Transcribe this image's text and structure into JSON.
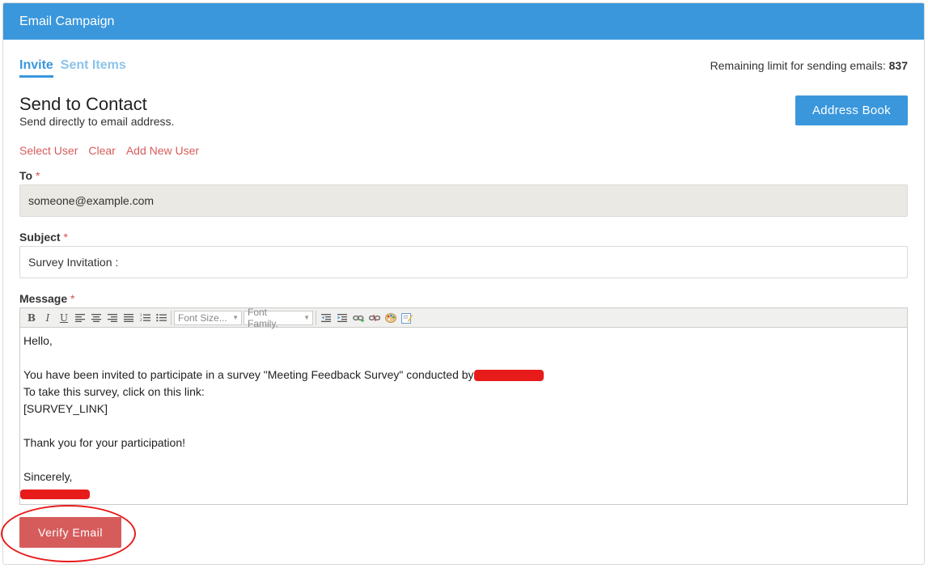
{
  "header": {
    "title": "Email Campaign"
  },
  "tabs": [
    {
      "label": "Invite",
      "active": true
    },
    {
      "label": "Sent Items",
      "active": false
    }
  ],
  "limit": {
    "label": "Remaining limit for sending emails: ",
    "value": "837"
  },
  "section": {
    "title": "Send to Contact",
    "subtitle": "Send directly to email address.",
    "address_book_label": "Address Book"
  },
  "user_links": [
    "Select User",
    "Clear",
    "Add New User"
  ],
  "fields": {
    "to_label": "To",
    "to_value": "someone@example.com",
    "subject_label": "Subject",
    "subject_value": "Survey Invitation :",
    "message_label": "Message",
    "required_mark": "*"
  },
  "toolbar": {
    "bold": "B",
    "italic": "I",
    "underline": "U",
    "font_size": "Font Size...",
    "font_family": "Font Family.",
    "icons": [
      "bold-icon",
      "italic-icon",
      "underline-icon",
      "align-left-icon",
      "align-center-icon",
      "align-right-icon",
      "justify-icon",
      "ordered-list-icon",
      "unordered-list-icon",
      "outdent-icon",
      "indent-icon",
      "link-icon",
      "unlink-icon",
      "color-palette-icon",
      "edit-source-icon"
    ]
  },
  "message": {
    "greeting": "Hello,",
    "line1": "You have been invited to participate in a survey \"Meeting Feedback Survey\" conducted by",
    "line2": "To take this survey, click on this link:",
    "line3": "[SURVEY_LINK]",
    "thanks": "Thank you for your participation!",
    "closing": "Sincerely,"
  },
  "actions": {
    "verify_label": "Verify Email"
  },
  "colors": {
    "primary": "#3a97dc",
    "danger": "#d65c5c",
    "annotation": "#e81b1b"
  }
}
